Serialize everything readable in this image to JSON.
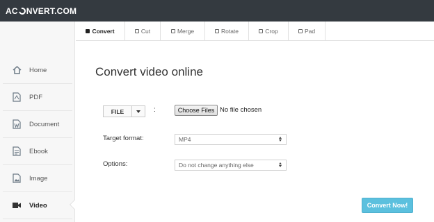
{
  "header": {
    "logo_left": "AC",
    "logo_right": "NVERT.COM",
    "background_color": "#343a40"
  },
  "sidebar": {
    "items": [
      {
        "label": "Home",
        "icon": "home-icon"
      },
      {
        "label": "PDF",
        "icon": "pdf-file-icon"
      },
      {
        "label": "Document",
        "icon": "word-document-icon"
      },
      {
        "label": "Ebook",
        "icon": "ebook-icon"
      },
      {
        "label": "Image",
        "icon": "image-icon"
      },
      {
        "label": "Video",
        "icon": "video-camera-icon",
        "active": true
      }
    ]
  },
  "tabs": [
    {
      "label": "Convert",
      "active": true
    },
    {
      "label": "Cut"
    },
    {
      "label": "Merge"
    },
    {
      "label": "Rotate"
    },
    {
      "label": "Crop"
    },
    {
      "label": "Pad"
    }
  ],
  "main": {
    "title": "Convert video online",
    "file_source_label": "FILE",
    "colon": ":",
    "choose_files_label": "Choose Files",
    "no_file_text": "No file chosen",
    "target_format_label": "Target format:",
    "target_format_value": "MP4",
    "options_label": "Options:",
    "options_value": "Do not change anything else",
    "convert_button_label": "Convert Now!",
    "convert_button_color": "#5bc0de"
  }
}
